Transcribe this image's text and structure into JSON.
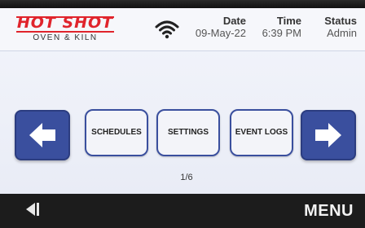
{
  "header": {
    "logo": {
      "brand": "HOT SHOT",
      "subtitle": "OVEN & KILN"
    },
    "date": {
      "label": "Date",
      "value": "09-May-22"
    },
    "time": {
      "label": "Time",
      "value": "6:39 PM"
    },
    "status": {
      "label": "Status",
      "value": "Admin"
    },
    "wifi_icon": "wifi-icon"
  },
  "main": {
    "buttons": [
      {
        "label": "SCHEDULES"
      },
      {
        "label": "SETTINGS"
      },
      {
        "label": "EVENT LOGS"
      }
    ],
    "prev_icon": "arrow-left-icon",
    "next_icon": "arrow-right-icon",
    "page_indicator": "1/6"
  },
  "footer": {
    "back_icon": "back-triangle-icon",
    "menu_label": "MENU"
  },
  "colors": {
    "accent": "#3a4f9e",
    "brand_red": "#e0242c",
    "screen_bg": "#eef1f8",
    "footer_bg": "#1c1c1c"
  }
}
